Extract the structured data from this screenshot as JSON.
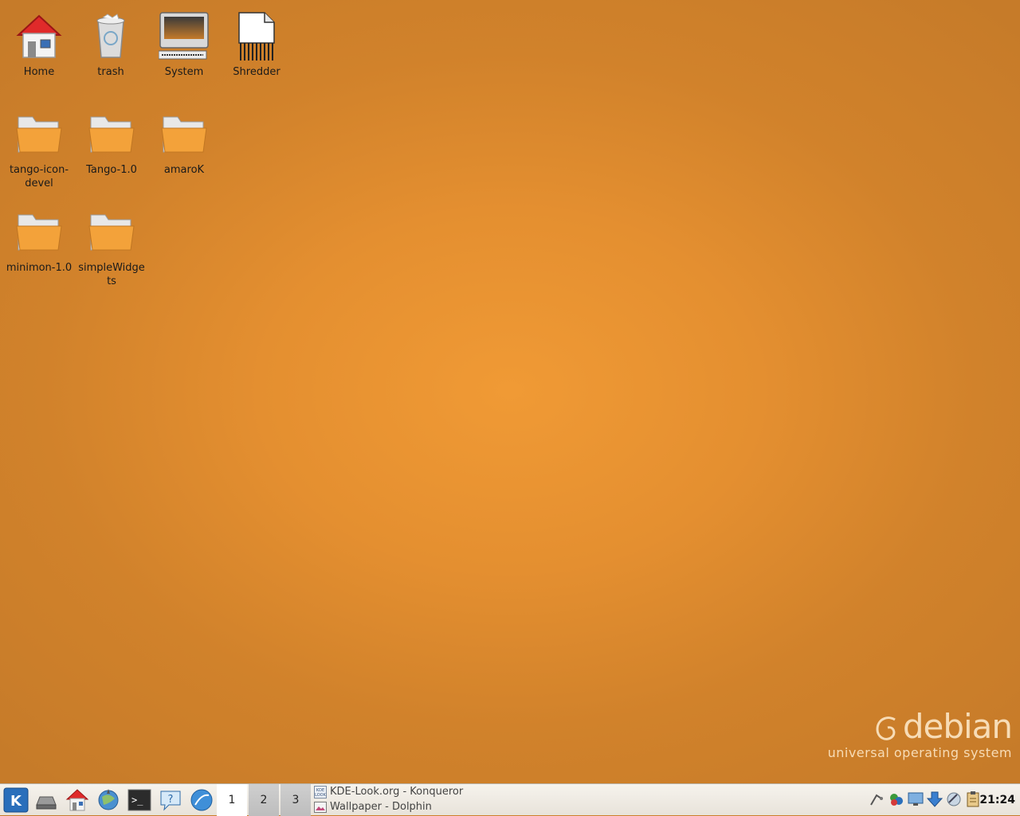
{
  "desktop": {
    "icons": [
      {
        "label": "Home",
        "icon": "home-icon"
      },
      {
        "label": "trash",
        "icon": "trash-icon"
      },
      {
        "label": "System",
        "icon": "computer-icon"
      },
      {
        "label": "Shredder",
        "icon": "shredder-icon"
      },
      {
        "label": "tango-icon-devel",
        "icon": "folder-icon"
      },
      {
        "label": "Tango-1.0",
        "icon": "folder-icon"
      },
      {
        "label": "amaroK",
        "icon": "folder-icon"
      },
      {
        "label": "minimon-1.0",
        "icon": "folder-icon"
      },
      {
        "label": "simpleWidgets",
        "icon": "folder-icon"
      }
    ]
  },
  "branding": {
    "logo": "debian",
    "tagline": "universal operating system"
  },
  "taskbar": {
    "launchers": [
      "kde-menu-icon",
      "storage-drive-icon",
      "home-folder-icon",
      "web-browser-icon",
      "terminal-icon",
      "help-icon",
      "music-player-icon"
    ],
    "pager": [
      "1",
      "2",
      "3"
    ],
    "active_desktop": "1",
    "tasks": [
      {
        "label": "KDE-Look.org - Konqueror",
        "icon": "kde-look-icon"
      },
      {
        "label": "Wallpaper - Dolphin",
        "icon": "dolphin-icon"
      }
    ],
    "tray": [
      "network-icon",
      "color-picker-icon",
      "display-icon",
      "download-icon",
      "satellite-icon",
      "clipboard-icon"
    ],
    "clock": "21:24"
  },
  "colors": {
    "wallpaper_center": "#f09a35",
    "wallpaper_edge": "#c67b29",
    "folder": "#f2a33a"
  }
}
